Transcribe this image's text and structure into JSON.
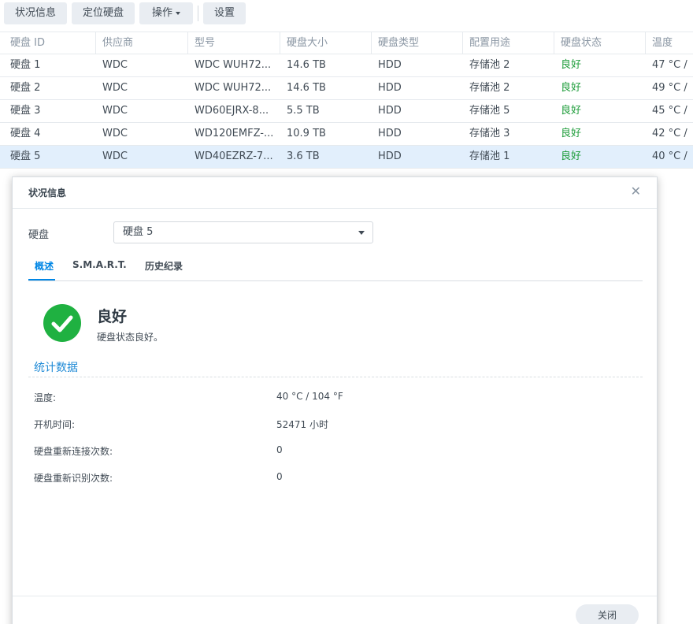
{
  "toolbar": {
    "buttons": [
      "状况信息",
      "定位硬盘",
      "操作",
      "设置"
    ]
  },
  "table": {
    "headers": [
      "硬盘 ID",
      "供应商",
      "型号",
      "硬盘大小",
      "硬盘类型",
      "配置用途",
      "硬盘状态",
      "温度"
    ],
    "rows": [
      [
        "硬盘 1",
        "WDC",
        "WDC WUH72...",
        "14.6 TB",
        "HDD",
        "存储池 2",
        "良好",
        "47 °C /"
      ],
      [
        "硬盘 2",
        "WDC",
        "WDC WUH72...",
        "14.6 TB",
        "HDD",
        "存储池 2",
        "良好",
        "49 °C /"
      ],
      [
        "硬盘 3",
        "WDC",
        "WD60EJRX-8...",
        "5.5 TB",
        "HDD",
        "存储池 5",
        "良好",
        "45 °C /"
      ],
      [
        "硬盘 4",
        "WDC",
        "WD120EMFZ-...",
        "10.9 TB",
        "HDD",
        "存储池 3",
        "良好",
        "42 °C /"
      ],
      [
        "硬盘 5",
        "WDC",
        "WD40EZRZ-7...",
        "3.6 TB",
        "HDD",
        "存储池 1",
        "良好",
        "40 °C /"
      ]
    ],
    "selected_row": 4
  },
  "dialog": {
    "title": "状况信息",
    "disk_label": "硬盘",
    "disk_selected": "硬盘 5",
    "tabs": [
      "概述",
      "S.M.A.R.T.",
      "历史纪录"
    ],
    "active_tab": "概述",
    "status_title": "良好",
    "status_desc": "硬盘状态良好。",
    "section_title": "统计数据",
    "stats": [
      {
        "label": "温度:",
        "value": "40 °C / 104 °F"
      },
      {
        "label": "开机时间:",
        "value": "52471 小时"
      },
      {
        "label": "硬盘重新连接次数:",
        "value": "0"
      },
      {
        "label": "硬盘重新识别次数:",
        "value": "0"
      }
    ],
    "close_label": "关闭"
  },
  "colors": {
    "accent": "#0086e5",
    "good": "#1f9d3b",
    "good_icon": "#1fb141",
    "selected_row": "#e2effc"
  },
  "icons": {
    "status": "check-circle-icon",
    "close": "close-icon",
    "dropdown": "chevron-down-icon"
  }
}
